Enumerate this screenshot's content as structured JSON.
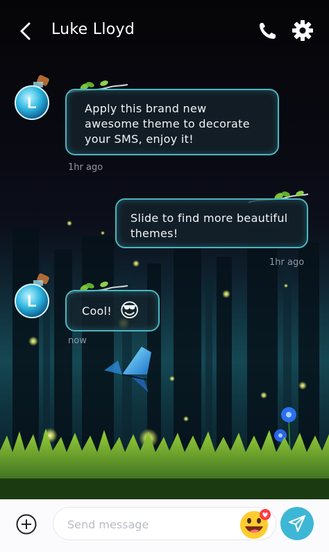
{
  "header": {
    "contact_name": "Luke Lloyd",
    "avatar_letter": "L"
  },
  "messages": [
    {
      "direction": "incoming",
      "text_lines": [
        "Apply this brand new",
        "awesome theme to decorate",
        "your SMS, enjoy it!"
      ],
      "timestamp": "1hr ago"
    },
    {
      "direction": "outgoing",
      "text_lines": [
        "Slide to find more beautiful",
        "themes!"
      ],
      "timestamp": "1hr ago"
    },
    {
      "direction": "incoming",
      "text": "Cool!",
      "emoji": "😎",
      "timestamp": "now"
    }
  ],
  "composer": {
    "placeholder": "Send message",
    "emoji_badge": "heart"
  },
  "colors": {
    "bubble_border": "#49b7c2",
    "send_button": "#3db7d5",
    "header_text": "#ffffff",
    "timestamp": "#8e98a4"
  }
}
